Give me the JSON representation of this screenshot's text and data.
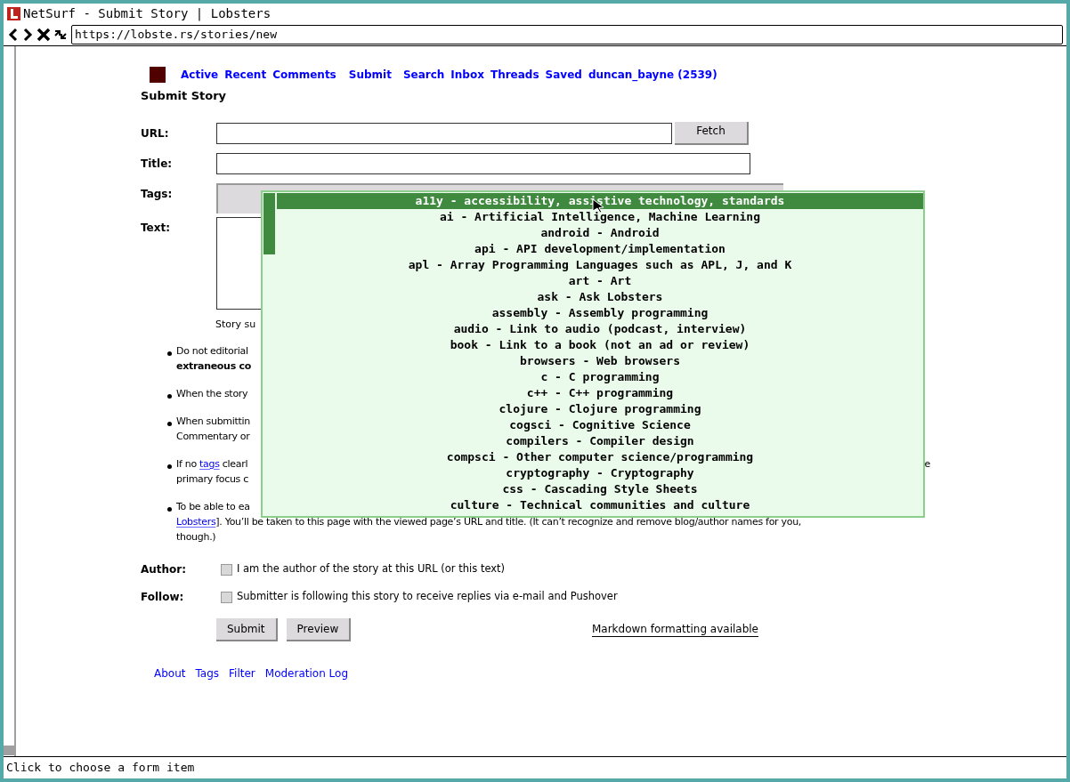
{
  "window": {
    "title": "NetSurf - Submit Story | Lobsters"
  },
  "toolbar": {
    "url": "https://lobste.rs/stories/new"
  },
  "nav": {
    "links": [
      "Active",
      "Recent",
      "Comments",
      "Submit",
      "Search",
      "Inbox",
      "Threads",
      "Saved",
      "duncan_bayne (2539)"
    ]
  },
  "page_title": "Submit Story",
  "form": {
    "url_label": "URL:",
    "fetch_button": "Fetch",
    "title_label": "Title:",
    "tags_label": "Tags:",
    "text_label": "Text:",
    "text_note": "Story su"
  },
  "guidelines": [
    {
      "lines": [
        [
          {
            "kind": "text",
            "text": "Do not editorial"
          }
        ],
        [
          {
            "kind": "bold",
            "text": "extraneous co"
          }
        ]
      ]
    },
    {
      "lines": [
        [
          {
            "kind": "text",
            "text": "When the story"
          }
        ]
      ]
    },
    {
      "lines": [
        [
          {
            "kind": "text",
            "text": "When submittin"
          }
        ],
        [
          {
            "kind": "text",
            "text": "Commentary or"
          }
        ]
      ]
    },
    {
      "lines": [
        [
          {
            "kind": "text",
            "text": "If no "
          },
          {
            "kind": "link",
            "text": "tags"
          },
          {
            "kind": "text",
            "text": " clearl"
          },
          {
            "kind": "tail",
            "text": "e"
          }
        ],
        [
          {
            "kind": "text",
            "text": "primary focus c"
          }
        ]
      ]
    },
    {
      "lines": [
        [
          {
            "kind": "text",
            "text": "To be able to ea"
          }
        ],
        [
          {
            "kind": "link",
            "text": "Lobsters"
          },
          {
            "kind": "text",
            "text": "]. You’ll be taken to this page with the viewed page’s URL and title. (It can’t recognize and remove blog/author names for you,"
          }
        ],
        [
          {
            "kind": "text",
            "text": "though.)"
          }
        ]
      ]
    }
  ],
  "author": {
    "label": "Author:",
    "checked": false,
    "text": "I am the author of the story at this URL (or this text)"
  },
  "follow": {
    "label": "Follow:",
    "checked": false,
    "text": "Submitter is following this story to receive replies via e-mail and Pushover"
  },
  "buttons": [
    "Submit",
    "Preview"
  ],
  "markdown_link": "Markdown formatting available",
  "footer": [
    "About",
    "Tags",
    "Filter",
    "Moderation Log"
  ],
  "dropdown": [
    {
      "text": "a11y - accessibility, assistive technology, standards",
      "selected": true
    },
    {
      "text": "ai - Artificial Intelligence, Machine Learning",
      "selected": false
    },
    {
      "text": "android - Android",
      "selected": false
    },
    {
      "text": "api - API development/implementation",
      "selected": false
    },
    {
      "text": "apl - Array Programming Languages such as APL, J, and K",
      "selected": false
    },
    {
      "text": "art - Art",
      "selected": false
    },
    {
      "text": "ask - Ask Lobsters",
      "selected": false
    },
    {
      "text": "assembly - Assembly programming",
      "selected": false
    },
    {
      "text": "audio - Link to audio (podcast, interview)",
      "selected": false
    },
    {
      "text": "book - Link to a book (not an ad or review)",
      "selected": false
    },
    {
      "text": "browsers - Web browsers",
      "selected": false
    },
    {
      "text": "c - C programming",
      "selected": false
    },
    {
      "text": "c++ - C++ programming",
      "selected": false
    },
    {
      "text": "clojure - Clojure programming",
      "selected": false
    },
    {
      "text": "cogsci - Cognitive Science",
      "selected": false
    },
    {
      "text": "compilers - Compiler design",
      "selected": false
    },
    {
      "text": "compsci - Other computer science/programming",
      "selected": false
    },
    {
      "text": "cryptography - Cryptography",
      "selected": false
    },
    {
      "text": "css - Cascading Style Sheets",
      "selected": false
    },
    {
      "text": "culture - Technical communities and culture",
      "selected": false
    }
  ],
  "status_bar": "Click to choose a form item"
}
